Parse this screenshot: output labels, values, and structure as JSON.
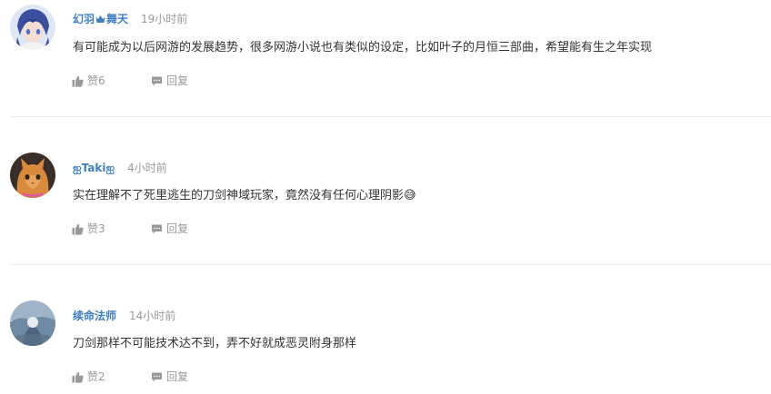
{
  "comments": [
    {
      "username": "幻羽",
      "username_suffix": "舞天",
      "time": "19小时前",
      "content": "有可能成为以后网游的发展趋势，很多网游小说也有类似的设定，比如叶子的月恒三部曲，希望能有生之年实现",
      "like_label": "赞6",
      "reply_label": "回复"
    },
    {
      "username": "ஐTakiஐ",
      "time": "4小时前",
      "content": "实在理解不了死里逃生的刀剑神域玩家，竟然没有任何心理阴影😅",
      "like_label": "赞3",
      "reply_label": "回复"
    },
    {
      "username": "续命法师",
      "time": "14小时前",
      "content": "刀剑那样不可能技术达不到，弄不好就成恶灵附身那样",
      "like_label": "赞2",
      "reply_label": "回复"
    }
  ],
  "colors": {
    "username": "#3f7fc1",
    "meta": "#999999",
    "text": "#333333",
    "divider": "#ececec"
  },
  "icons": {
    "like": "thumbs-up-icon",
    "reply": "speech-bubble-icon",
    "badge": "crown-icon"
  }
}
